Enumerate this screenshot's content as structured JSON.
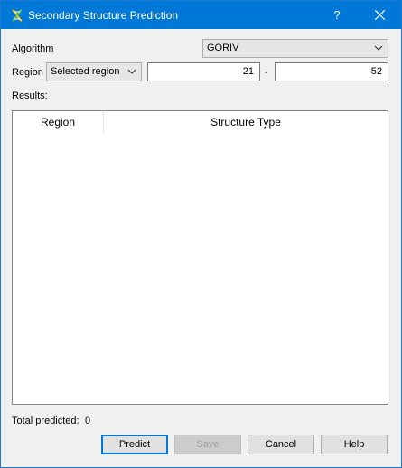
{
  "window": {
    "title": "Secondary Structure Prediction",
    "help_label": "?"
  },
  "form": {
    "algorithm_label": "Algorithm",
    "algorithm_value": "GORIV",
    "region_label": "Region",
    "region_mode": "Selected region",
    "region_start": "21",
    "region_separator": "-",
    "region_end": "52",
    "results_label": "Results:"
  },
  "table": {
    "columns": [
      "Region",
      "Structure Type"
    ],
    "rows": []
  },
  "footer": {
    "total_label": "Total predicted:",
    "total_value": "0"
  },
  "buttons": {
    "predict": "Predict",
    "save": "Save",
    "cancel": "Cancel",
    "help": "Help"
  },
  "colors": {
    "titlebar": "#0078d7",
    "accent": "#0078d7"
  }
}
